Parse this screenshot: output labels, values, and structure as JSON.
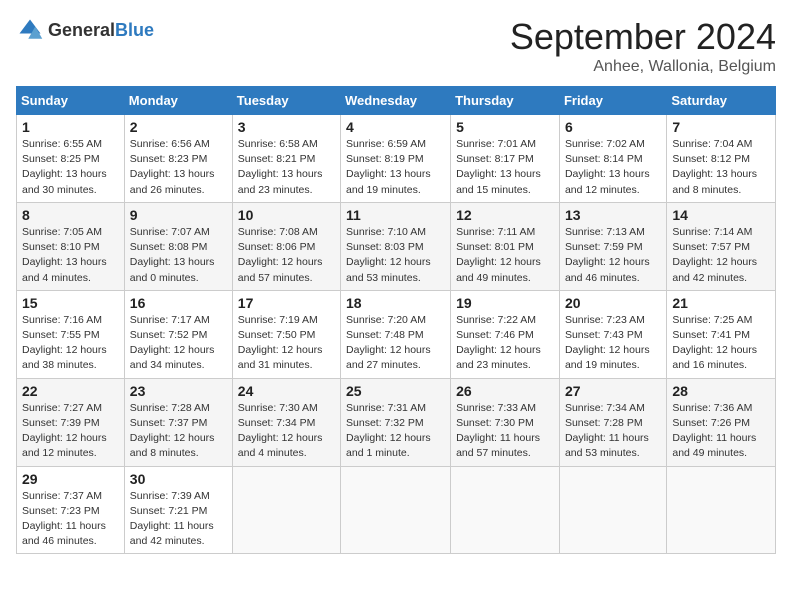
{
  "header": {
    "logo_general": "General",
    "logo_blue": "Blue",
    "month": "September 2024",
    "location": "Anhee, Wallonia, Belgium"
  },
  "weekdays": [
    "Sunday",
    "Monday",
    "Tuesday",
    "Wednesday",
    "Thursday",
    "Friday",
    "Saturday"
  ],
  "weeks": [
    [
      {
        "day": "1",
        "info": "Sunrise: 6:55 AM\nSunset: 8:25 PM\nDaylight: 13 hours\nand 30 minutes."
      },
      {
        "day": "2",
        "info": "Sunrise: 6:56 AM\nSunset: 8:23 PM\nDaylight: 13 hours\nand 26 minutes."
      },
      {
        "day": "3",
        "info": "Sunrise: 6:58 AM\nSunset: 8:21 PM\nDaylight: 13 hours\nand 23 minutes."
      },
      {
        "day": "4",
        "info": "Sunrise: 6:59 AM\nSunset: 8:19 PM\nDaylight: 13 hours\nand 19 minutes."
      },
      {
        "day": "5",
        "info": "Sunrise: 7:01 AM\nSunset: 8:17 PM\nDaylight: 13 hours\nand 15 minutes."
      },
      {
        "day": "6",
        "info": "Sunrise: 7:02 AM\nSunset: 8:14 PM\nDaylight: 13 hours\nand 12 minutes."
      },
      {
        "day": "7",
        "info": "Sunrise: 7:04 AM\nSunset: 8:12 PM\nDaylight: 13 hours\nand 8 minutes."
      }
    ],
    [
      {
        "day": "8",
        "info": "Sunrise: 7:05 AM\nSunset: 8:10 PM\nDaylight: 13 hours\nand 4 minutes."
      },
      {
        "day": "9",
        "info": "Sunrise: 7:07 AM\nSunset: 8:08 PM\nDaylight: 13 hours\nand 0 minutes."
      },
      {
        "day": "10",
        "info": "Sunrise: 7:08 AM\nSunset: 8:06 PM\nDaylight: 12 hours\nand 57 minutes."
      },
      {
        "day": "11",
        "info": "Sunrise: 7:10 AM\nSunset: 8:03 PM\nDaylight: 12 hours\nand 53 minutes."
      },
      {
        "day": "12",
        "info": "Sunrise: 7:11 AM\nSunset: 8:01 PM\nDaylight: 12 hours\nand 49 minutes."
      },
      {
        "day": "13",
        "info": "Sunrise: 7:13 AM\nSunset: 7:59 PM\nDaylight: 12 hours\nand 46 minutes."
      },
      {
        "day": "14",
        "info": "Sunrise: 7:14 AM\nSunset: 7:57 PM\nDaylight: 12 hours\nand 42 minutes."
      }
    ],
    [
      {
        "day": "15",
        "info": "Sunrise: 7:16 AM\nSunset: 7:55 PM\nDaylight: 12 hours\nand 38 minutes."
      },
      {
        "day": "16",
        "info": "Sunrise: 7:17 AM\nSunset: 7:52 PM\nDaylight: 12 hours\nand 34 minutes."
      },
      {
        "day": "17",
        "info": "Sunrise: 7:19 AM\nSunset: 7:50 PM\nDaylight: 12 hours\nand 31 minutes."
      },
      {
        "day": "18",
        "info": "Sunrise: 7:20 AM\nSunset: 7:48 PM\nDaylight: 12 hours\nand 27 minutes."
      },
      {
        "day": "19",
        "info": "Sunrise: 7:22 AM\nSunset: 7:46 PM\nDaylight: 12 hours\nand 23 minutes."
      },
      {
        "day": "20",
        "info": "Sunrise: 7:23 AM\nSunset: 7:43 PM\nDaylight: 12 hours\nand 19 minutes."
      },
      {
        "day": "21",
        "info": "Sunrise: 7:25 AM\nSunset: 7:41 PM\nDaylight: 12 hours\nand 16 minutes."
      }
    ],
    [
      {
        "day": "22",
        "info": "Sunrise: 7:27 AM\nSunset: 7:39 PM\nDaylight: 12 hours\nand 12 minutes."
      },
      {
        "day": "23",
        "info": "Sunrise: 7:28 AM\nSunset: 7:37 PM\nDaylight: 12 hours\nand 8 minutes."
      },
      {
        "day": "24",
        "info": "Sunrise: 7:30 AM\nSunset: 7:34 PM\nDaylight: 12 hours\nand 4 minutes."
      },
      {
        "day": "25",
        "info": "Sunrise: 7:31 AM\nSunset: 7:32 PM\nDaylight: 12 hours\nand 1 minute."
      },
      {
        "day": "26",
        "info": "Sunrise: 7:33 AM\nSunset: 7:30 PM\nDaylight: 11 hours\nand 57 minutes."
      },
      {
        "day": "27",
        "info": "Sunrise: 7:34 AM\nSunset: 7:28 PM\nDaylight: 11 hours\nand 53 minutes."
      },
      {
        "day": "28",
        "info": "Sunrise: 7:36 AM\nSunset: 7:26 PM\nDaylight: 11 hours\nand 49 minutes."
      }
    ],
    [
      {
        "day": "29",
        "info": "Sunrise: 7:37 AM\nSunset: 7:23 PM\nDaylight: 11 hours\nand 46 minutes."
      },
      {
        "day": "30",
        "info": "Sunrise: 7:39 AM\nSunset: 7:21 PM\nDaylight: 11 hours\nand 42 minutes."
      },
      {
        "day": "",
        "info": ""
      },
      {
        "day": "",
        "info": ""
      },
      {
        "day": "",
        "info": ""
      },
      {
        "day": "",
        "info": ""
      },
      {
        "day": "",
        "info": ""
      }
    ]
  ]
}
